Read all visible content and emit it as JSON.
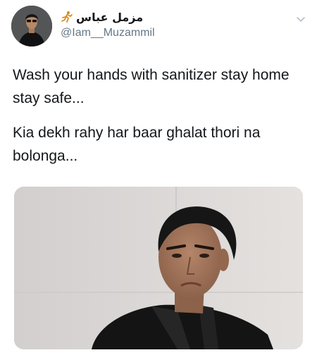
{
  "tweet": {
    "display_name": "مزمل عباس",
    "handle": "@Iam__Muzammil",
    "paragraphs": [
      "Wash your hands with sanitizer stay home stay safe...",
      "Kia dekh rahy har baar ghalat thori na bolonga..."
    ],
    "icons": {
      "avatar": "profile-photo",
      "name_badge": "running-figure-emoji",
      "menu": "chevron-down-icon"
    },
    "colors": {
      "text": "#14171a",
      "secondary_text": "#657786",
      "background": "#ffffff"
    }
  }
}
